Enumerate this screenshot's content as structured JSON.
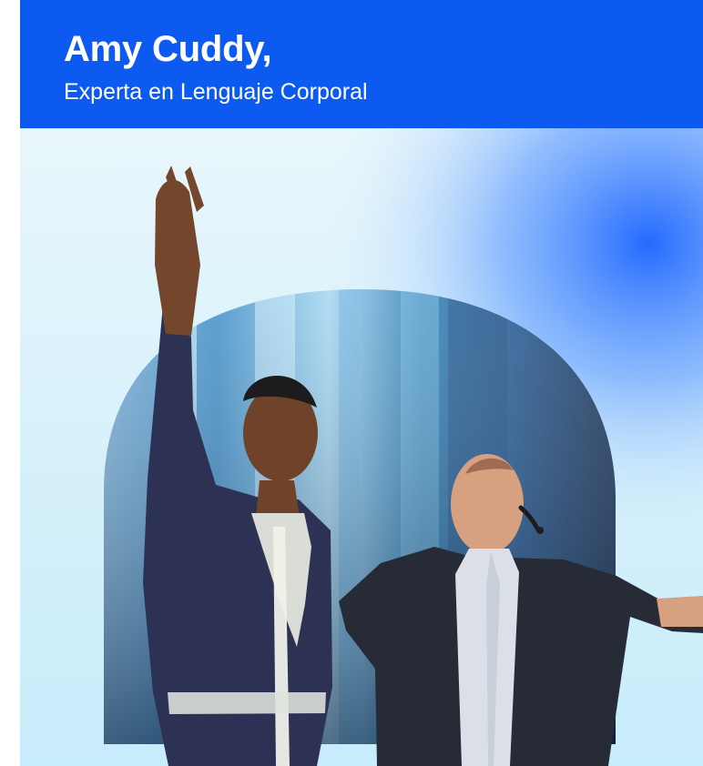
{
  "header": {
    "title": "Amy Cuddy,",
    "subtitle": "Experta en Lenguaje Corporal"
  },
  "colors": {
    "header_background": "#0d5af0",
    "header_text": "#ffffff",
    "hero_background": "#dff3fb",
    "accent_glow": "#1b63ff"
  }
}
